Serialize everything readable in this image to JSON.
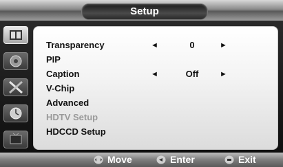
{
  "header": {
    "title": "Setup"
  },
  "sidebar": {
    "items": [
      {
        "icon": "picture-icon",
        "active": true
      },
      {
        "icon": "audio-icon",
        "active": false
      },
      {
        "icon": "tools-icon",
        "active": false
      },
      {
        "icon": "clock-icon",
        "active": false
      },
      {
        "icon": "tv-icon",
        "active": false
      }
    ]
  },
  "menu": {
    "items": [
      {
        "label": "Transparency",
        "value": "0",
        "has_arrows": true,
        "disabled": false
      },
      {
        "label": "PIP",
        "value": "",
        "has_arrows": false,
        "disabled": false
      },
      {
        "label": "Caption",
        "value": "Off",
        "has_arrows": true,
        "disabled": false
      },
      {
        "label": "V-Chip",
        "value": "",
        "has_arrows": false,
        "disabled": false
      },
      {
        "label": "Advanced",
        "value": "",
        "has_arrows": false,
        "disabled": false
      },
      {
        "label": "HDTV Setup",
        "value": "",
        "has_arrows": false,
        "disabled": true
      },
      {
        "label": "HDCCD Setup",
        "value": "",
        "has_arrows": false,
        "disabled": false
      }
    ],
    "arrow_left": "◄",
    "arrow_right": "►"
  },
  "footer": {
    "move_label": "Move",
    "enter_label": "Enter",
    "exit_label": "Exit"
  }
}
